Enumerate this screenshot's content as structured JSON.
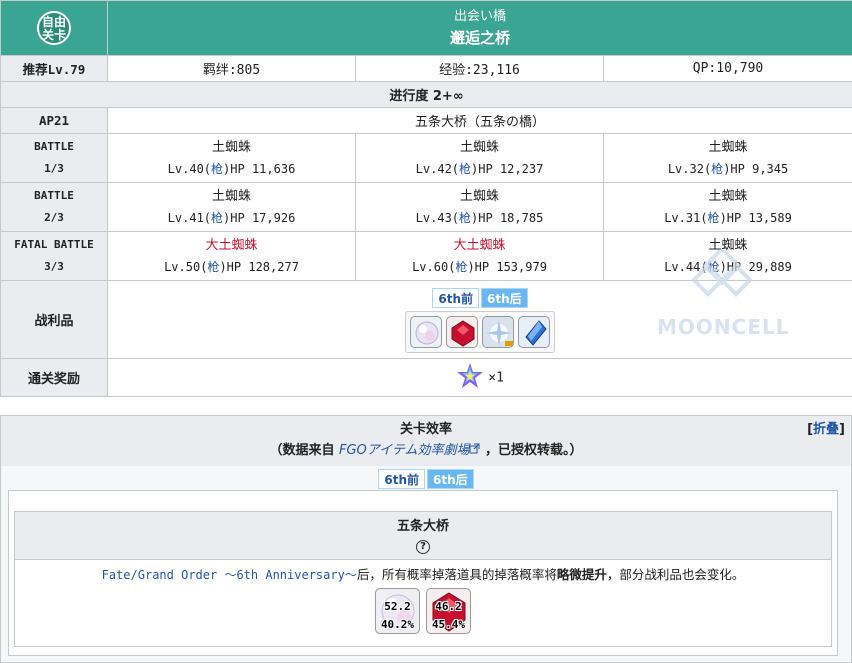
{
  "header": {
    "badge": "自由\n关卡",
    "jp_name": "出会い橋",
    "cn_name": "邂逅之桥"
  },
  "info_row": {
    "level": "推荐Lv.79",
    "bond": "羁绊:805",
    "exp": "经验:23,116",
    "qp": "QP:10,790"
  },
  "progress": "进行度 2+∞",
  "ap_row": {
    "ap": "AP21",
    "location": "五条大桥（五条の橋）"
  },
  "battles": [
    {
      "label": "BATTLE",
      "count": "1/3",
      "enemies": [
        {
          "name": "土蜘蛛",
          "lv": "Lv.40",
          "cls": "枪",
          "hp": "HP 11,636",
          "highlight": false
        },
        {
          "name": "土蜘蛛",
          "lv": "Lv.42",
          "cls": "枪",
          "hp": "HP 12,237",
          "highlight": false
        },
        {
          "name": "土蜘蛛",
          "lv": "Lv.32",
          "cls": "枪",
          "hp": "HP 9,345",
          "highlight": false
        }
      ]
    },
    {
      "label": "BATTLE",
      "count": "2/3",
      "enemies": [
        {
          "name": "土蜘蛛",
          "lv": "Lv.41",
          "cls": "枪",
          "hp": "HP 17,926",
          "highlight": false
        },
        {
          "name": "土蜘蛛",
          "lv": "Lv.43",
          "cls": "枪",
          "hp": "HP 18,785",
          "highlight": false
        },
        {
          "name": "土蜘蛛",
          "lv": "Lv.31",
          "cls": "枪",
          "hp": "HP 13,589",
          "highlight": false
        }
      ]
    },
    {
      "label": "FATAL BATTLE",
      "count": "3/3",
      "enemies": [
        {
          "name": "大土蜘蛛",
          "lv": "Lv.50",
          "cls": "枪",
          "hp": "HP 128,277",
          "highlight": true
        },
        {
          "name": "大土蜘蛛",
          "lv": "Lv.60",
          "cls": "枪",
          "hp": "HP 153,979",
          "highlight": true
        },
        {
          "name": "土蜘蛛",
          "lv": "Lv.44",
          "cls": "枪",
          "hp": "HP 29,889",
          "highlight": false
        }
      ]
    }
  ],
  "loot": {
    "label": "战利品",
    "tabs": [
      "6th前",
      "6th后"
    ],
    "items": [
      "pearl-item-icon",
      "red-gem-item-icon",
      "spark-item-icon",
      "blue-crystal-item-icon"
    ]
  },
  "reward": {
    "label": "通关奖励",
    "quantity": "×1",
    "icon": "saint-quartz-icon"
  },
  "watermark": "MOONCELL",
  "efficiency": {
    "title": "关卡效率",
    "source_prefix": "（数据来自",
    "source_link": "FGOアイテム効率劇場",
    "source_suffix": "，已授权转载。）",
    "collapse": "折叠",
    "tabs": [
      "6th前",
      "6th后"
    ],
    "place": "五条大桥",
    "help": "?",
    "note_link": "Fate/Grand Order ～6th Anniversary～",
    "note_a": "后，所有概率掉落道具的掉落概率将",
    "note_bold": "略微提升",
    "note_b": "，部分战利品也会变化。",
    "drops": [
      {
        "icon": "pearl-drop-icon",
        "v1": "52.2",
        "v2": "40.2%"
      },
      {
        "icon": "red-gem-drop-icon",
        "v1": "46.2",
        "v2": "45.4%"
      }
    ]
  },
  "colors": {
    "header_teal": "#3aa592",
    "label_gray": "#eaecf0",
    "boss_red": "#c8102e",
    "link_blue": "#2255a4",
    "tab_blue": "#68b7f0"
  }
}
